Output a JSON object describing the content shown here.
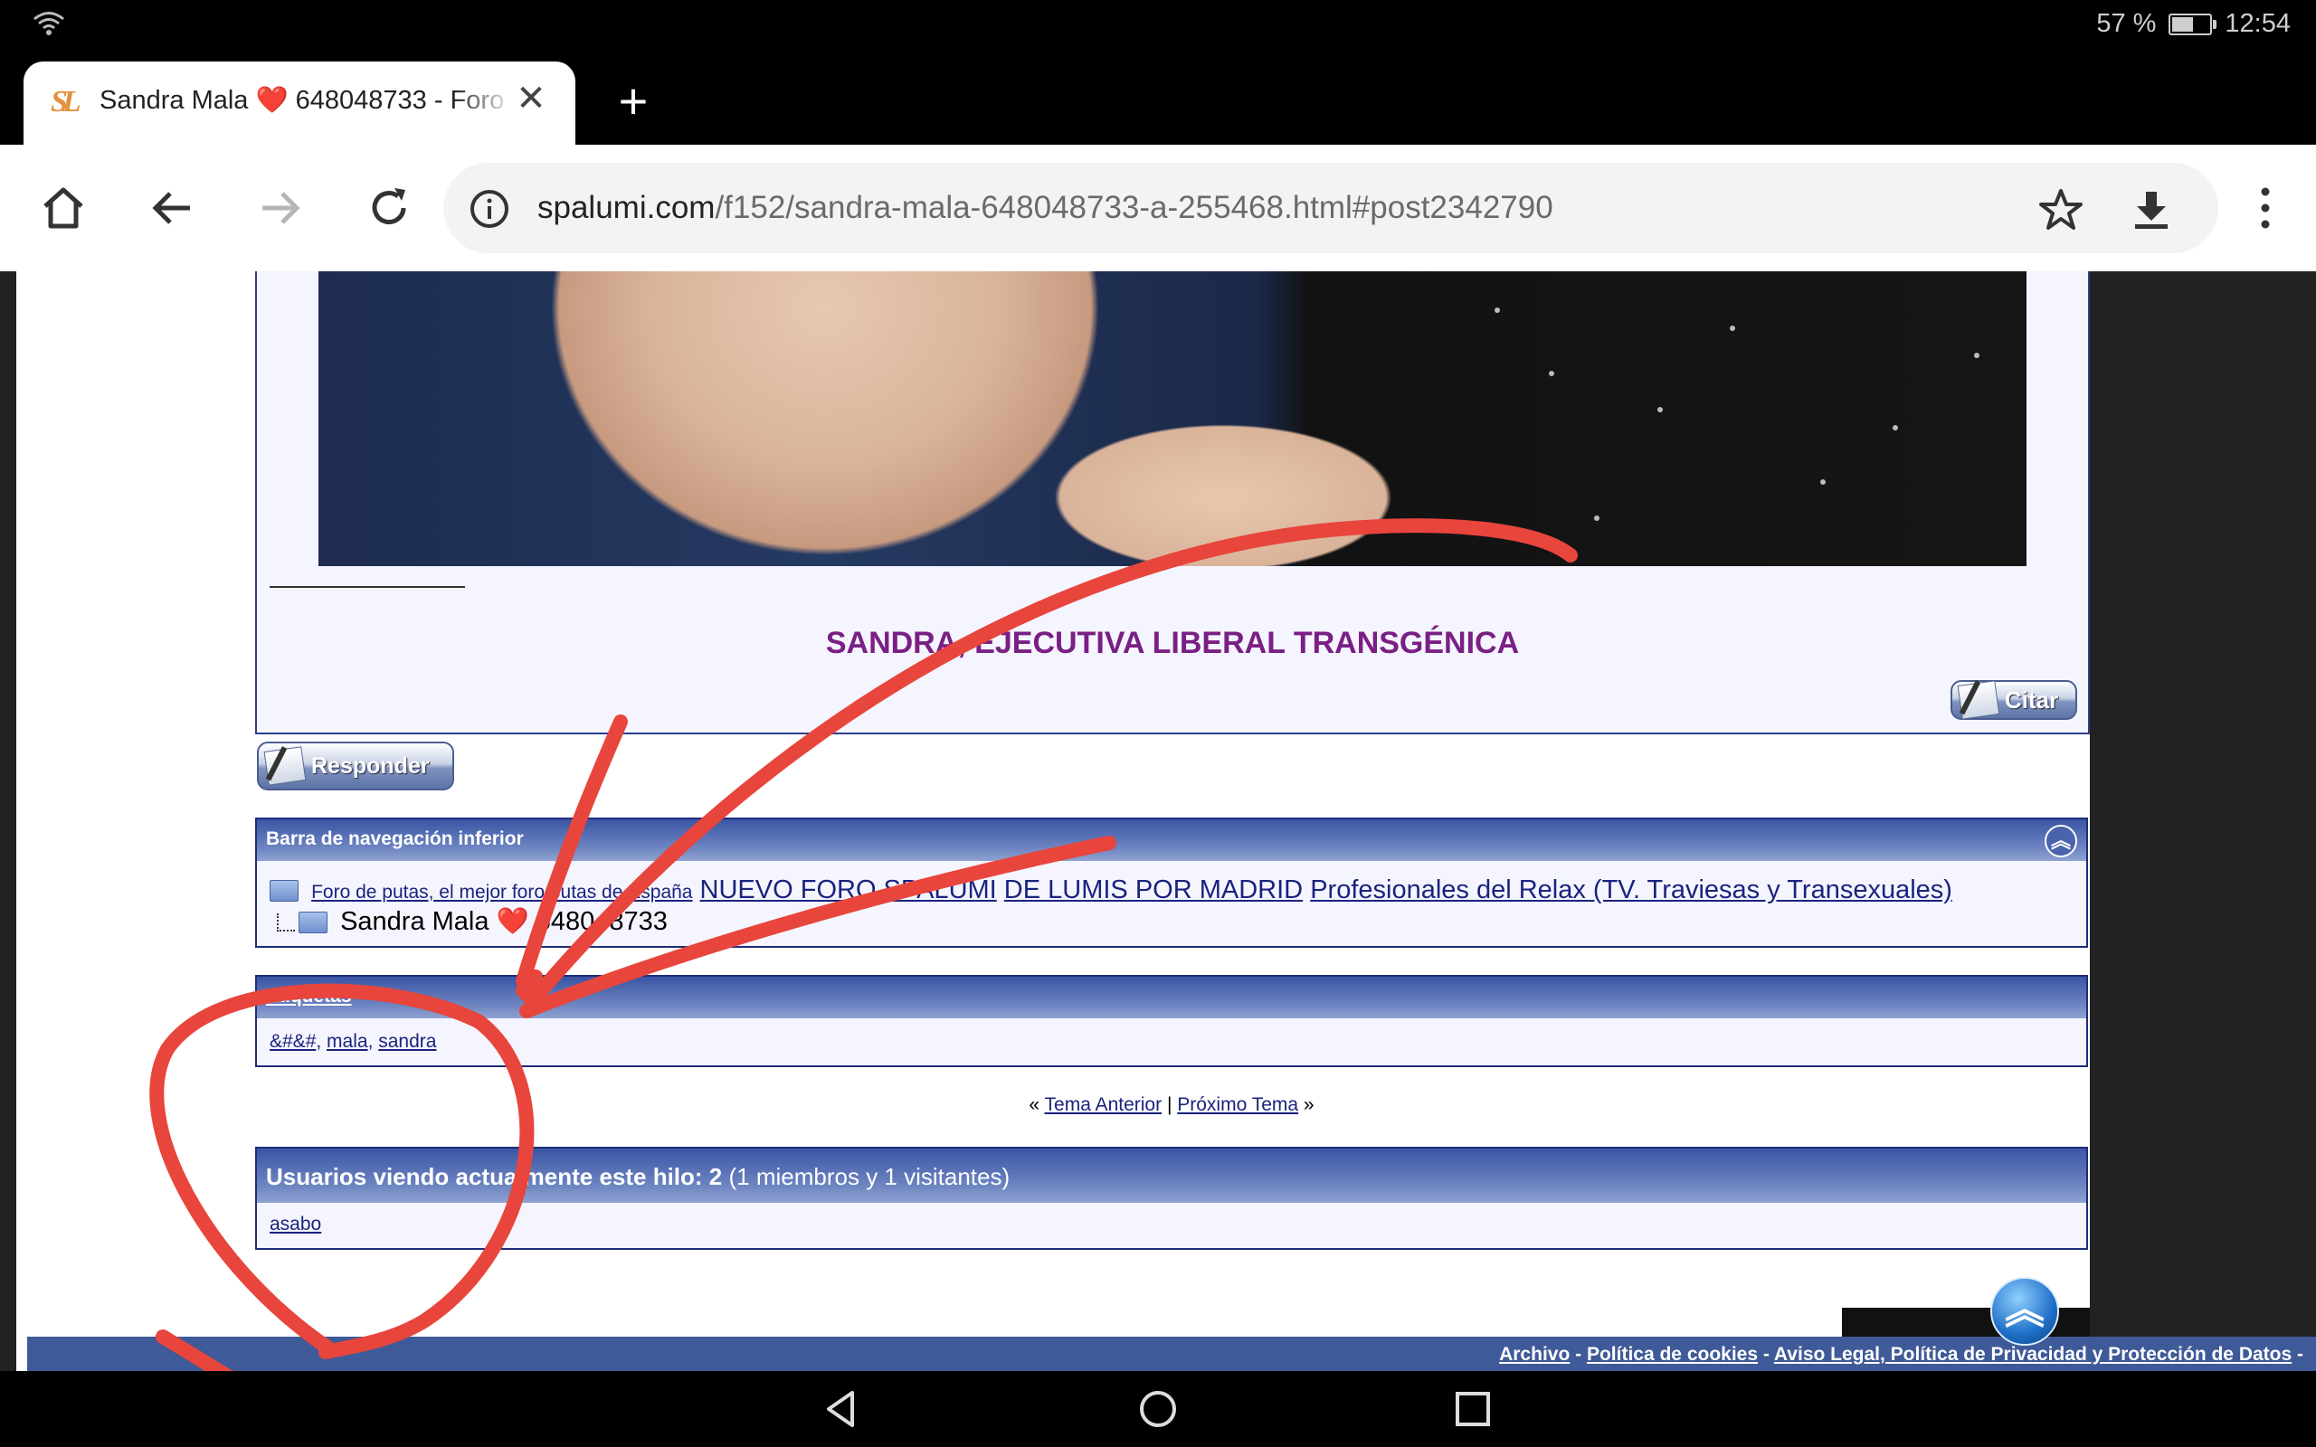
{
  "status_bar": {
    "battery_text": "57 %",
    "battery_level": 0.57,
    "time": "12:54"
  },
  "tab": {
    "title": "Sandra Mala ❤️ 648048733 - Foro",
    "favicon_text": "SL"
  },
  "toolbar": {
    "url_host": "spalumi.com",
    "url_path": "/f152/sandra-mala-648048733-a-255468.html#post2342790"
  },
  "post": {
    "title": "SANDRA, EJECUTIVA LIBERAL TRANSGÉNICA",
    "quote_label": "Citar"
  },
  "reply_label": "Responder",
  "nav_panel": {
    "heading": "Barra de navegación inferior",
    "crumb_root": "Foro de putas, el mejor foro putas de España",
    "crumb_1": "NUEVO FORO SPALUMI",
    "crumb_2": "DE LUMIS POR MADRID",
    "crumb_3": "Profesionales del Relax (TV. Traviesas y Transexuales)",
    "current": "Sandra Mala ❤️ 648048733"
  },
  "tags_panel": {
    "heading": "Etiquetas",
    "tags": [
      "&#&#",
      "mala",
      "sandra"
    ]
  },
  "thread_nav": {
    "prev": "Tema Anterior",
    "next": "Próximo Tema",
    "separator": "|"
  },
  "viewers": {
    "heading_bold": "Usuarios viendo actualmente este hilo: 2",
    "heading_normal": "(1 miembros y 1 visitantes)",
    "user": "asabo"
  },
  "footer": {
    "archive": "Archivo",
    "cookies": "Política de cookies",
    "legal": "Aviso Legal, Política de Privacidad y Protección de Datos"
  },
  "colors": {
    "annotation": "#e8453c",
    "panel_header": "#3a55a4",
    "post_title": "#7a1f84",
    "link": "#1a237e"
  }
}
